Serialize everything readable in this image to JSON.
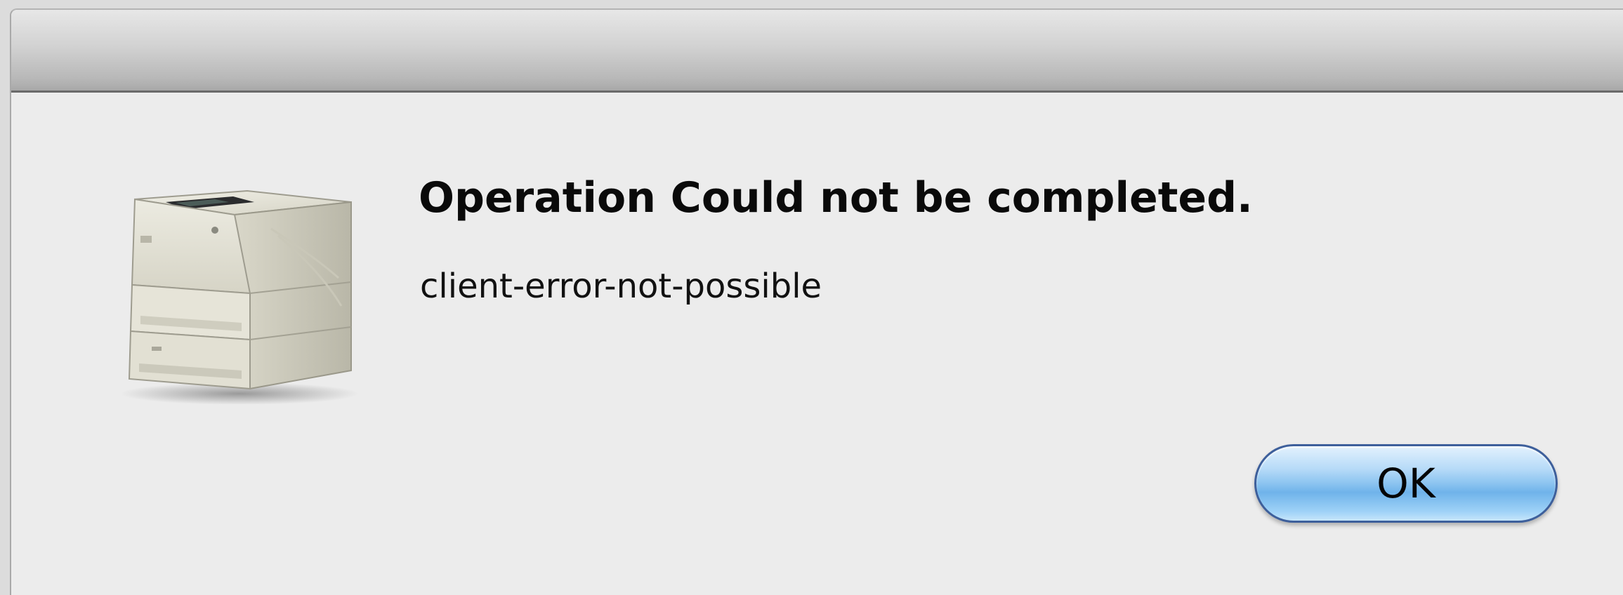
{
  "dialog": {
    "title": "Operation Could not be completed.",
    "message": "client-error-not-possible",
    "ok_label": "OK"
  },
  "icons": {
    "alert_icon": "printer-icon"
  },
  "colors": {
    "window_background": "#ececec",
    "titlebar": "#c4c4c4",
    "ok_button": "#8cc4f0"
  }
}
